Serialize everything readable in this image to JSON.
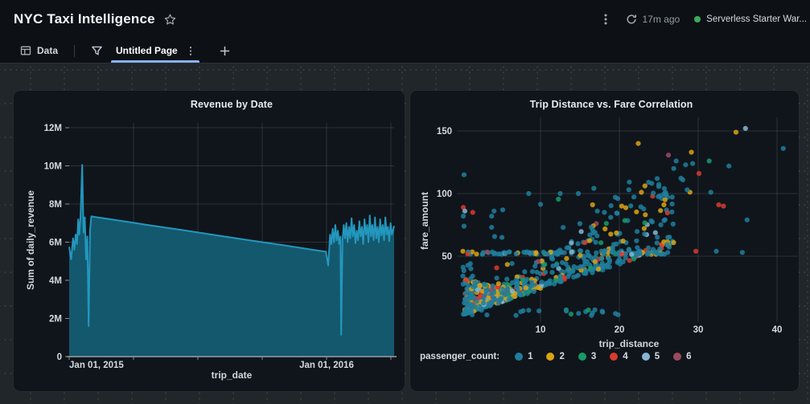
{
  "header": {
    "title": "NYC Taxi Intelligence",
    "last_refresh": "17m ago",
    "warehouse_name": "Serverless Starter War...",
    "warehouse_status_color": "#3CA95C"
  },
  "tabbar": {
    "data_tab": "Data",
    "page_tab": "Untitled Page",
    "active_underline_color": "#84B2F5"
  },
  "icons": {
    "favorite": "star-outline",
    "overflow": "kebab-vertical",
    "refresh": "circular-arrow",
    "data_tab": "table-grid",
    "filter": "funnel",
    "add_page": "plus",
    "warehouse_status": "green-dot"
  },
  "palette": {
    "header_bg": "#0D1116",
    "canvas_bg": "#21262A",
    "card_bg": "#10151C",
    "grid_line": "rgba(255,255,255,0.12)",
    "axis_line": "#9AA0A6",
    "tick_text": "#D4D9DE"
  },
  "chart_data": [
    {
      "type": "area",
      "title": "Revenue by Date",
      "xlabel": "trip_date",
      "ylabel": "Sum of daily_revenue",
      "ylim": [
        0,
        12000000
      ],
      "y_ticks": [
        "0",
        "2M",
        "4M",
        "6M",
        "8M",
        "10M",
        "12M"
      ],
      "x_ticks": [
        {
          "t": 0.084,
          "label": "Jan 01, 2015"
        },
        {
          "t": 0.792,
          "label": "Jan 01, 2016"
        }
      ],
      "grid_t": [
        0.198,
        0.396,
        0.594,
        0.792,
        0.99
      ],
      "line_color": "#2397BE",
      "fill_color": "#14586D",
      "points_unit": "millions_of_dollars; t = fraction of x range (Dec 2014 - Mar 2016)",
      "points": [
        [
          0,
          5.75
        ],
        [
          0.006,
          5.1
        ],
        [
          0.012,
          6.2
        ],
        [
          0.016,
          5.6
        ],
        [
          0.02,
          6.4
        ],
        [
          0.024,
          5.9
        ],
        [
          0.028,
          7.2
        ],
        [
          0.031,
          6.4
        ],
        [
          0.035,
          7.3
        ],
        [
          0.04,
          10.05
        ],
        [
          0.044,
          6.5
        ],
        [
          0.048,
          7.3
        ],
        [
          0.052,
          5.1
        ],
        [
          0.056,
          6.3
        ],
        [
          0.06,
          1.6
        ],
        [
          0.064,
          6.6
        ],
        [
          0.068,
          7.35
        ],
        [
          0.15,
          7.14
        ],
        [
          0.25,
          6.88
        ],
        [
          0.35,
          6.63
        ],
        [
          0.45,
          6.37
        ],
        [
          0.55,
          6.11
        ],
        [
          0.65,
          5.86
        ],
        [
          0.75,
          5.6
        ],
        [
          0.79,
          5.5
        ],
        [
          0.797,
          4.77
        ],
        [
          0.803,
          6.4
        ],
        [
          0.807,
          5.9
        ],
        [
          0.811,
          6.7
        ],
        [
          0.815,
          6.0
        ],
        [
          0.819,
          6.9
        ],
        [
          0.823,
          6.1
        ],
        [
          0.827,
          6.6
        ],
        [
          0.831,
          5.9
        ],
        [
          0.835,
          6.3
        ],
        [
          0.837,
          1.15
        ],
        [
          0.841,
          6.1
        ],
        [
          0.845,
          6.9
        ],
        [
          0.849,
          6.2
        ],
        [
          0.853,
          7.0
        ],
        [
          0.857,
          6.0
        ],
        [
          0.861,
          6.8
        ],
        [
          0.865,
          6.2
        ],
        [
          0.869,
          7.25
        ],
        [
          0.873,
          6.3
        ],
        [
          0.877,
          6.9
        ],
        [
          0.881,
          5.95
        ],
        [
          0.885,
          6.6
        ],
        [
          0.889,
          6.1
        ],
        [
          0.893,
          7.1
        ],
        [
          0.897,
          6.3
        ],
        [
          0.901,
          6.8
        ],
        [
          0.905,
          5.9
        ],
        [
          0.909,
          7.2
        ],
        [
          0.913,
          6.4
        ],
        [
          0.917,
          6.9
        ],
        [
          0.921,
          6.0
        ],
        [
          0.925,
          7.4
        ],
        [
          0.929,
          6.3
        ],
        [
          0.933,
          6.9
        ],
        [
          0.937,
          6.1
        ],
        [
          0.941,
          7.3
        ],
        [
          0.945,
          6.2
        ],
        [
          0.949,
          6.8
        ],
        [
          0.953,
          6.0
        ],
        [
          0.957,
          7.2
        ],
        [
          0.961,
          6.35
        ],
        [
          0.965,
          6.9
        ],
        [
          0.969,
          6.1
        ],
        [
          0.973,
          7.3
        ],
        [
          0.977,
          6.4
        ],
        [
          0.981,
          6.8
        ],
        [
          0.985,
          6.05
        ],
        [
          0.989,
          7.0
        ],
        [
          0.993,
          6.4
        ],
        [
          1,
          6.85
        ]
      ]
    },
    {
      "type": "scatter",
      "title": "Trip Distance vs. Fare Correlation",
      "xlabel": "trip_distance",
      "ylabel": "fare_amount",
      "xlim": [
        -0.4,
        42.6
      ],
      "ylim": [
        0,
        162
      ],
      "x_ticks": [
        10,
        20,
        30,
        40
      ],
      "y_ticks": [
        50,
        100,
        150
      ],
      "legend": {
        "label": "passenger_count:",
        "entries": [
          {
            "value": "1",
            "color": "#1F7E9C"
          },
          {
            "value": "2",
            "color": "#D9A313"
          },
          {
            "value": "3",
            "color": "#179A67"
          },
          {
            "value": "4",
            "color": "#D93B2B"
          },
          {
            "value": "5",
            "color": "#86B7D4"
          },
          {
            "value": "6",
            "color": "#9D4A5F"
          }
        ]
      },
      "point_radius": 3.1,
      "point_opacity": 0.85,
      "seed": 20150101,
      "distribution_note": "dense linear band fare~2-4.2x distance, flat JFK-style band at fare~52.5, sparse high-fare cloud",
      "clusters": [
        {
          "kind": "band",
          "n": 560,
          "x": {
            "min": 0.4,
            "span": 26.5,
            "pow": 1.6
          },
          "params": {
            "a": 2.0,
            "b": 2.2,
            "c": 3,
            "d": 3
          },
          "weights": [
            0.7,
            0.86,
            0.905,
            0.95,
            0.98,
            1
          ]
        },
        {
          "kind": "wedge",
          "n": 200,
          "x": {
            "min": 0.4,
            "span": 5.6,
            "pow": 1.2
          },
          "params": {
            "a": 2.0,
            "c": 3,
            "top": 29,
            "taper": 3.2
          },
          "weights": [
            0.52,
            0.78,
            0.85,
            0.91,
            0.96,
            1
          ]
        },
        {
          "kind": "flat",
          "n": 85,
          "x": {
            "min": 0.3,
            "span": 26.7,
            "pow": 1
          },
          "params": {
            "base": 52.5,
            "noise": 2.2
          },
          "weights": [
            0.78,
            0.9,
            0.92,
            0.96,
            0.99,
            1
          ]
        },
        {
          "kind": "low",
          "n": 20,
          "x": {
            "min": 2,
            "span": 20,
            "pow": 1
          },
          "params": {
            "base": 2.5,
            "noise": 5
          },
          "weights": [
            0.92,
            0.96,
            0.97,
            0.98,
            0.99,
            1
          ]
        },
        {
          "kind": "high",
          "n": 45,
          "x": {
            "min": 4,
            "span": 26,
            "pow": 1.3
          },
          "params": {
            "slope": 2.6,
            "off": 12,
            "spread": 55
          },
          "weights": [
            0.62,
            0.82,
            0.87,
            0.93,
            0.97,
            1
          ]
        },
        {
          "kind": "column",
          "n": 30,
          "x": {
            "min": 0.15,
            "span": 1.3,
            "pow": 1
          },
          "params": {
            "base": 3,
            "spread": 42
          },
          "weights": [
            0.85,
            0.92,
            0.94,
            0.97,
            0.99,
            1
          ]
        }
      ],
      "outliers": [
        [
          0.3,
          115,
          1
        ],
        [
          8.5,
          100,
          1
        ],
        [
          14.8,
          100,
          1
        ],
        [
          12.5,
          100,
          1
        ],
        [
          22.4,
          140,
          2
        ],
        [
          34.8,
          149,
          2
        ],
        [
          36,
          152,
          5
        ],
        [
          40.8,
          136,
          1
        ],
        [
          31.4,
          126,
          3
        ],
        [
          27.2,
          126,
          1
        ],
        [
          33.9,
          122,
          1
        ],
        [
          30.1,
          116,
          4
        ],
        [
          32.6,
          91,
          4
        ],
        [
          33.2,
          90,
          4
        ],
        [
          29.7,
          54,
          4
        ],
        [
          32.3,
          54,
          1
        ],
        [
          35.6,
          53,
          1
        ],
        [
          0.2,
          89,
          4
        ],
        [
          0.4,
          86,
          5
        ],
        [
          1.4,
          85,
          4
        ],
        [
          0.2,
          82,
          1
        ],
        [
          0.3,
          74,
          1
        ],
        [
          3.8,
          82,
          1
        ],
        [
          4.1,
          86,
          1
        ],
        [
          5.2,
          87,
          1
        ],
        [
          5.1,
          65,
          1
        ],
        [
          16.6,
          91,
          2
        ],
        [
          17.2,
          86,
          1
        ],
        [
          18.1,
          85,
          1
        ],
        [
          21.2,
          103,
          1
        ],
        [
          23.7,
          109,
          1
        ],
        [
          22.8,
          101,
          2
        ],
        [
          25.8,
          95,
          2
        ],
        [
          28.6,
          103,
          1
        ],
        [
          31.6,
          101,
          1
        ],
        [
          24.8,
          112,
          1
        ],
        [
          26.9,
          120,
          1
        ],
        [
          29.3,
          124,
          1
        ],
        [
          19.8,
          96,
          1
        ],
        [
          20.3,
          90,
          2
        ],
        [
          36.2,
          79,
          1
        ],
        [
          3.8,
          73,
          1
        ],
        [
          0.15,
          54,
          2
        ]
      ]
    }
  ]
}
